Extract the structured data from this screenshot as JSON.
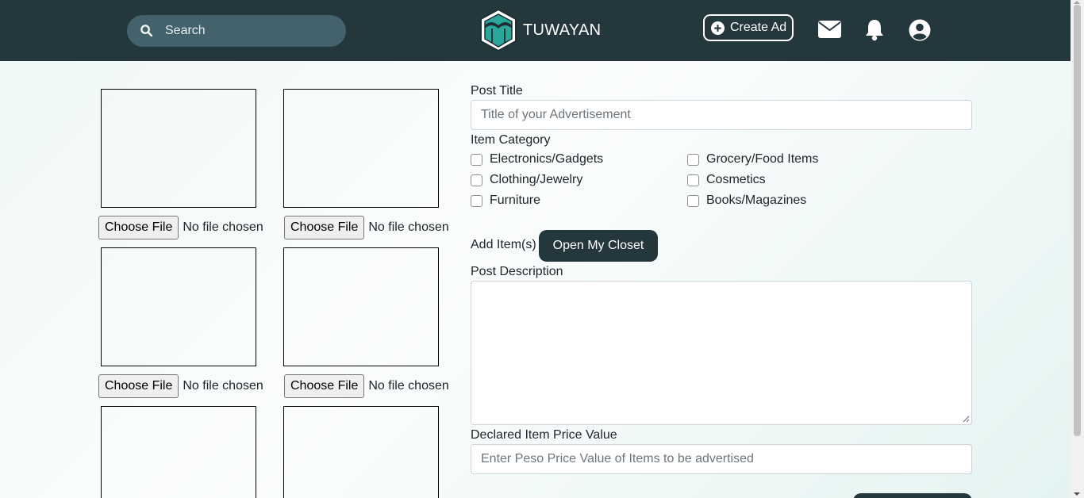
{
  "navbar": {
    "search_placeholder": "Search",
    "brand_name": "TUWAYAN",
    "create_ad_label": "Create Ad",
    "colors": {
      "navbar_bg": "#24373d",
      "search_bg": "#43626b",
      "logo_teal": "#2aa79b"
    }
  },
  "uploads": {
    "choose_file_label": "Choose File",
    "no_file_text": "No file chosen"
  },
  "form": {
    "post_title_label": "Post Title",
    "post_title_placeholder": "Title of your Advertisement",
    "item_category_label": "Item Category",
    "categories": [
      "Electronics/Gadgets",
      "Grocery/Food Items",
      "Clothing/Jewelry",
      "Cosmetics",
      "Furniture",
      "Books/Magazines"
    ],
    "add_items_label": "Add Item(s)",
    "open_closet_label": "Open My Closet",
    "post_description_label": "Post Description",
    "price_label": "Declared Item Price Value",
    "price_placeholder": "Enter Peso Price Value of Items to be advertised"
  }
}
